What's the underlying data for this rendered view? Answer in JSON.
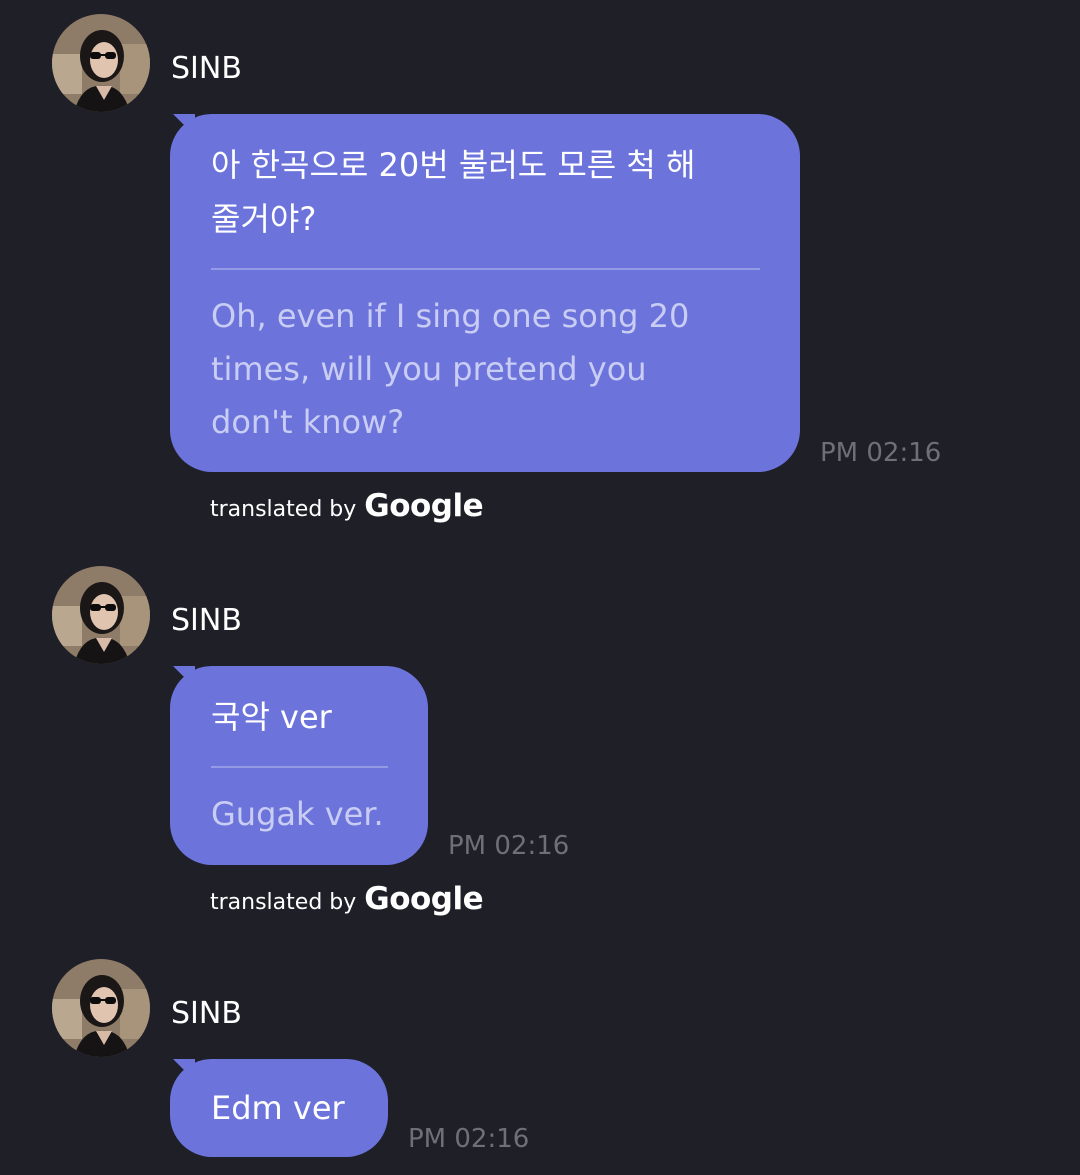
{
  "messages": [
    {
      "sender": "SINB",
      "original": "아 한곡으로 20번 불러도 모른 척 해\n줄거야?",
      "translation": "Oh, even if I sing one song 20\ntimes, will you pretend you\ndon't know?",
      "time": "PM 02:16",
      "attribution_prefix": "translated by",
      "attribution_brand": "Google"
    },
    {
      "sender": "SINB",
      "original": "국악 ver",
      "translation": "Gugak ver.",
      "time": "PM 02:16",
      "attribution_prefix": "translated by",
      "attribution_brand": "Google"
    },
    {
      "sender": "SINB",
      "original": "Edm ver",
      "time": "PM 02:16"
    }
  ],
  "colors": {
    "background": "#1f1f27",
    "bubble": "#6c74dc",
    "timestamp": "#6f7077",
    "translation_text": "#c9cdf3"
  },
  "icons": {
    "avatar": "profile-photo"
  }
}
